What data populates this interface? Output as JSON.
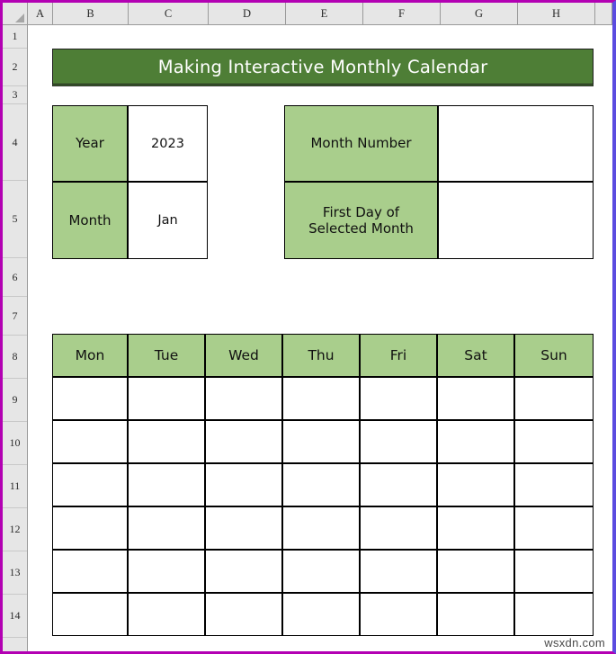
{
  "spreadsheet": {
    "column_headers": [
      "A",
      "B",
      "C",
      "D",
      "E",
      "F",
      "G",
      "H"
    ],
    "row_headers": [
      "1",
      "2",
      "3",
      "4",
      "5",
      "6",
      "7",
      "8",
      "9",
      "10",
      "11",
      "12",
      "13",
      "14"
    ],
    "select_all_icon": "select-all-corner-triangle"
  },
  "title": {
    "text": "Making Interactive Monthly Calendar",
    "fill_color": "#4E7E36",
    "text_color": "#FFFFFF"
  },
  "left_panel": {
    "rows": [
      {
        "label": "Year",
        "value": "2023"
      },
      {
        "label": "Month",
        "value": "Jan"
      }
    ]
  },
  "right_panel": {
    "rows": [
      {
        "label": "Month Number",
        "value": ""
      },
      {
        "label": "First Day of\nSelected Month",
        "value": ""
      }
    ]
  },
  "calendar": {
    "day_headers": [
      "Mon",
      "Tue",
      "Wed",
      "Thu",
      "Fri",
      "Sat",
      "Sun"
    ],
    "weeks": [
      [
        "",
        "",
        "",
        "",
        "",
        "",
        ""
      ],
      [
        "",
        "",
        "",
        "",
        "",
        "",
        ""
      ],
      [
        "",
        "",
        "",
        "",
        "",
        "",
        ""
      ],
      [
        "",
        "",
        "",
        "",
        "",
        "",
        ""
      ],
      [
        "",
        "",
        "",
        "",
        "",
        "",
        ""
      ],
      [
        "",
        "",
        "",
        "",
        "",
        "",
        ""
      ]
    ]
  },
  "watermark": {
    "text": "wsxdn.com"
  },
  "colors": {
    "header_green": "#4E7E36",
    "label_green": "#A9CE8C",
    "grid_border": "#000000",
    "sheet_left_border": "#B300B3",
    "sheet_right_border": "#5B4CE0"
  }
}
